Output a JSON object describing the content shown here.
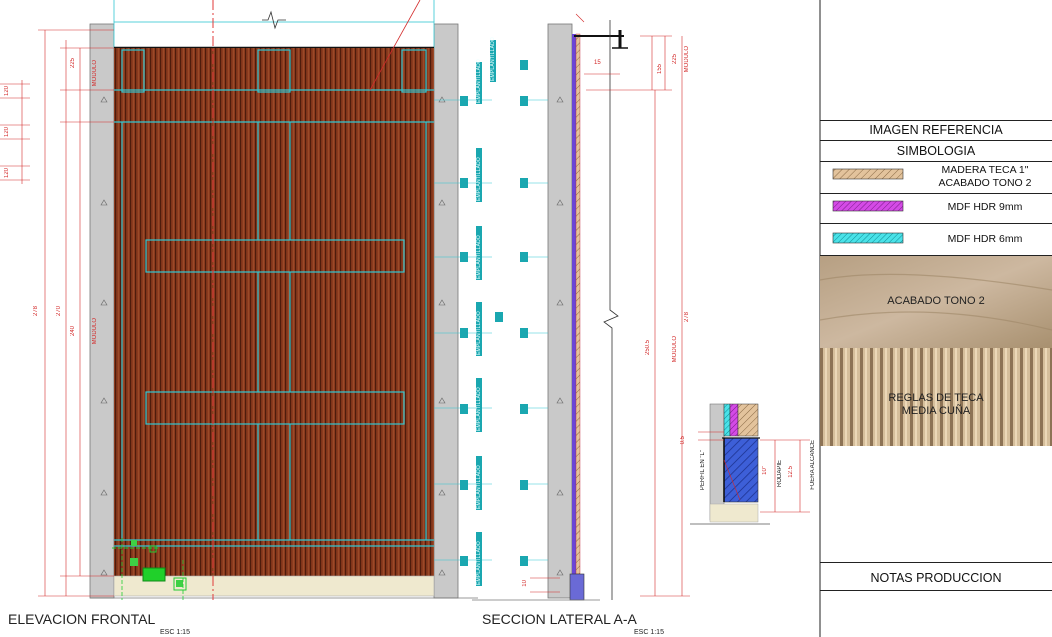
{
  "views": {
    "front_title": "ELEVACION FRONTAL",
    "front_scale": "ESC 1:15",
    "section_title": "SECCION LATERAL A-A",
    "section_scale": "ESC 1:15"
  },
  "tag_label": "EMPLANTILLADO",
  "dims": {
    "d225a": "225",
    "d120a": "120",
    "d120b": "120",
    "d120c": "120",
    "d278": "278",
    "d270": "270",
    "d240": "240",
    "modulo": "MODULO",
    "s15": "15",
    "s155": "155",
    "s225": "225",
    "s2505": "250.5",
    "s278": "278",
    "smodulo": "MODULO",
    "s10": "10",
    "d05": "0.5",
    "perfil": "PERFIL EN \"L\"",
    "d10in": "10\"",
    "rodapie": "RODAPIE",
    "d125": "12.5",
    "fuera": "FUERA ALCANCE"
  },
  "legend": {
    "image_ref": "IMAGEN REFERENCIA",
    "symbology": "SIMBOLOGIA",
    "items": [
      {
        "label1": "MADERA TECA 1\"",
        "label2": "ACABADO TONO 2",
        "color": "#d8b48a"
      },
      {
        "label1": "MDF HDR 9mm",
        "label2": "",
        "color": "#c43bd6"
      },
      {
        "label1": "MDF HDR 6mm",
        "label2": "",
        "color": "#33d6dc"
      }
    ],
    "photo1_label": "ACABADO TONO 2",
    "photo2_label1": "REGLAS DE TECA",
    "photo2_label2": "MEDIA CUÑA",
    "notes": "NOTAS PRODUCCION"
  },
  "colors": {
    "wood": "#8a3a1e",
    "wood_line": "#4e1c0c",
    "frame_cyan": "#31c7d2",
    "dim_red": "#d32a2a",
    "concrete": "#c9c9c9",
    "floor": "#efe9cf"
  }
}
